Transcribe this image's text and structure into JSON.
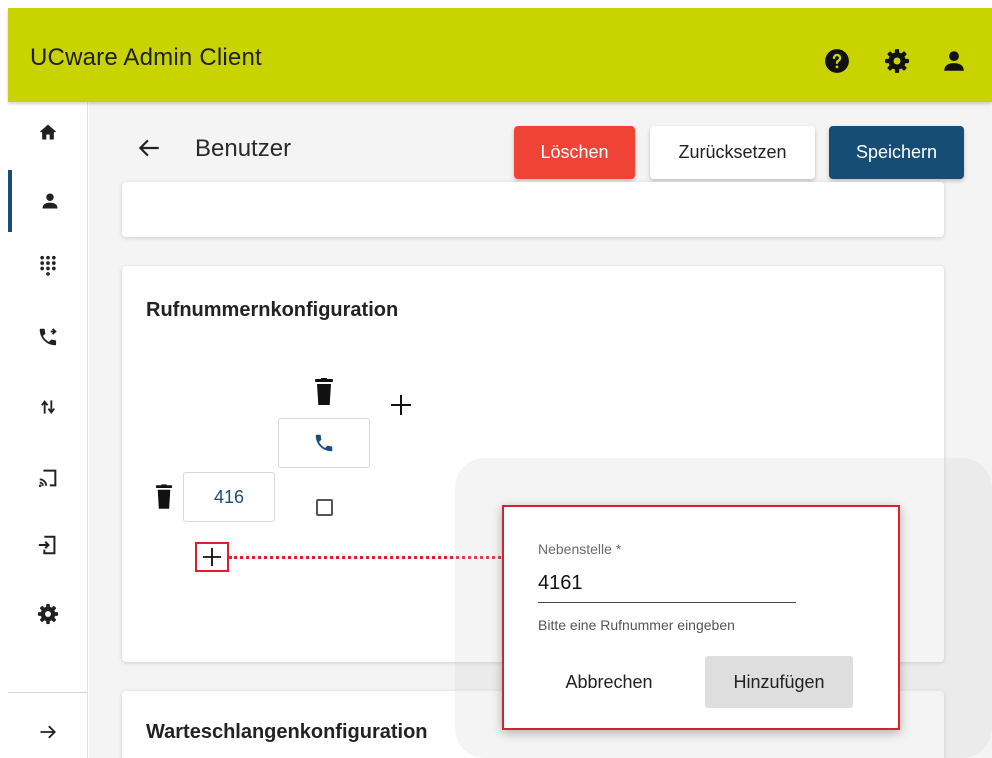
{
  "header": {
    "title": "UCware Admin Client",
    "icons": [
      "help-icon",
      "settings-icon",
      "account-icon"
    ],
    "background": "#c9d300"
  },
  "sidebar": {
    "items": [
      {
        "icon": "home-icon",
        "active": false
      },
      {
        "icon": "person-icon",
        "active": true
      },
      {
        "icon": "dialpad-icon",
        "active": false
      },
      {
        "icon": "phone-forwarded-icon",
        "active": false
      },
      {
        "icon": "swap-vert-icon",
        "active": false
      },
      {
        "icon": "cast-icon",
        "active": false
      },
      {
        "icon": "device-login-icon",
        "active": false
      },
      {
        "icon": "settings-icon",
        "active": false
      },
      {
        "icon": "expand-arrow-icon",
        "active": false
      }
    ],
    "active_color": "#1b4e79"
  },
  "page": {
    "title": "Benutzer",
    "buttons": {
      "delete": "Löschen",
      "reset": "Zurücksetzen",
      "save": "Speichern"
    },
    "colors": {
      "delete": "#ef4435",
      "save": "#154d76"
    }
  },
  "number_config": {
    "title": "Rufnummernkonfiguration",
    "extension": "416",
    "checkbox_checked": false
  },
  "queue_config": {
    "title": "Warteschlangenkonfiguration"
  },
  "dialog": {
    "field_label": "Nebenstelle *",
    "field_value": "4161",
    "hint": "Bitte eine Rufnummer eingeben",
    "cancel_label": "Abbrechen",
    "add_label": "Hinzufügen",
    "highlight_color": "#d8202f"
  }
}
